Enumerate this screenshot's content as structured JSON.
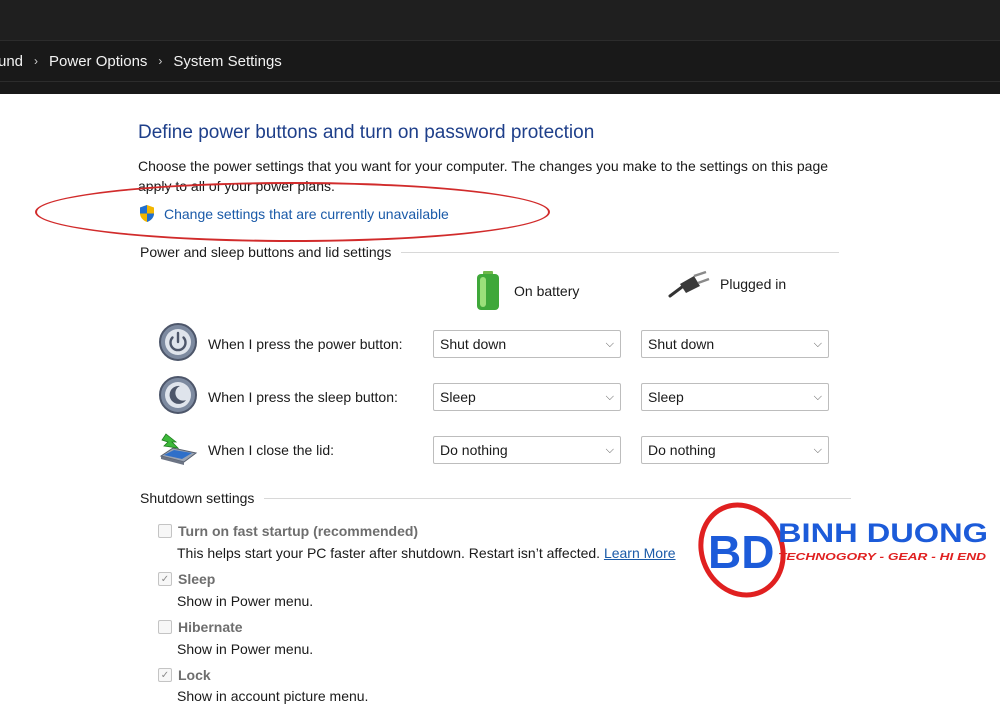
{
  "breadcrumb": {
    "items": [
      "und",
      "Power Options",
      "System Settings"
    ],
    "sep": "›"
  },
  "page": {
    "title": "Define power buttons and turn on password protection",
    "description": "Choose the power settings that you want for your computer. The changes you make to the settings on this page apply to all of your power plans.",
    "change_link": "Change settings that are currently unavailable"
  },
  "buttons_section": {
    "heading": "Power and sleep buttons and lid settings",
    "col_battery": "On battery",
    "col_plugged": "Plugged in",
    "rows": [
      {
        "label": "When I press the power button:",
        "battery": "Shut down",
        "plugged": "Shut down"
      },
      {
        "label": "When I press the sleep button:",
        "battery": "Sleep",
        "plugged": "Sleep"
      },
      {
        "label": "When I close the lid:",
        "battery": "Do nothing",
        "plugged": "Do nothing"
      }
    ]
  },
  "shutdown_section": {
    "heading": "Shutdown settings",
    "items": [
      {
        "label": "Turn on fast startup (recommended)",
        "checked": false,
        "desc": "This helps start your PC faster after shutdown. Restart isn’t affected.",
        "link": "Learn More"
      },
      {
        "label": "Sleep",
        "checked": true,
        "desc": "Show in Power menu."
      },
      {
        "label": "Hibernate",
        "checked": false,
        "desc": "Show in Power menu."
      },
      {
        "label": "Lock",
        "checked": true,
        "desc": "Show in account picture menu."
      }
    ]
  },
  "watermark": {
    "brand": "BINH DUONG",
    "tagline": "TECHNOGORY - GEAR - HI END",
    "mark": "BD"
  },
  "colors": {
    "title_blue": "#1e3f8a",
    "link_blue": "#1a5aa8",
    "annotation_red": "#d12b2b",
    "watermark_blue": "#1c5bd9",
    "watermark_red": "#e02020"
  }
}
